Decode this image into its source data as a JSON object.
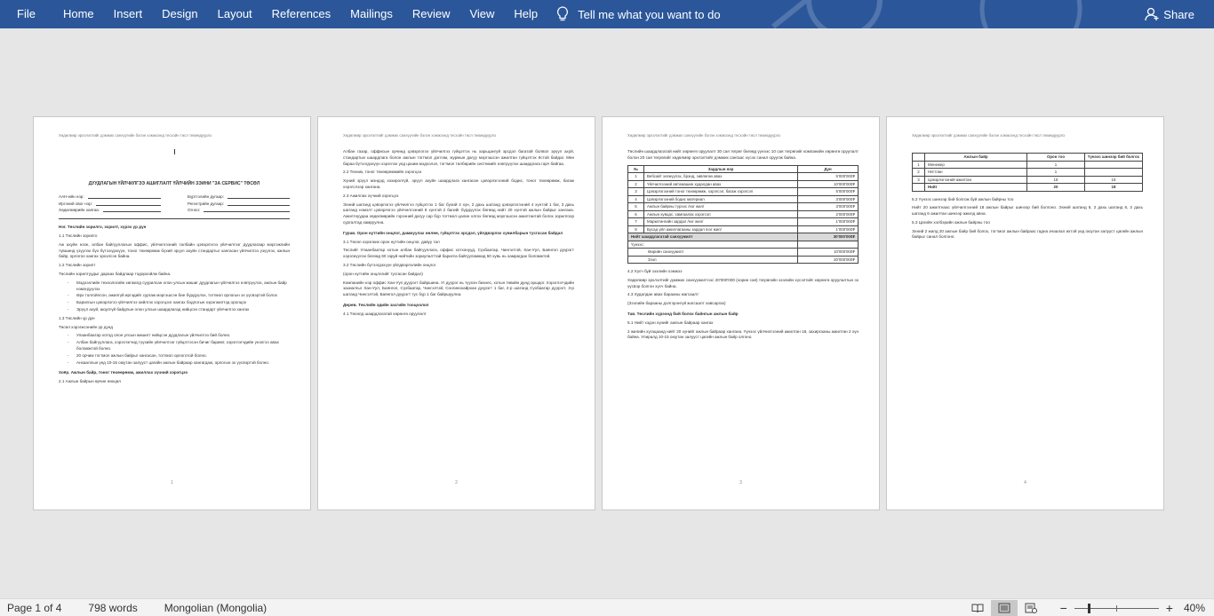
{
  "ribbon": {
    "tabs": [
      "File",
      "Home",
      "Insert",
      "Design",
      "Layout",
      "References",
      "Mailings",
      "Review",
      "View",
      "Help"
    ],
    "tell_me": "Tell me what you want to do",
    "share": "Share",
    "background_color": "#2b579a"
  },
  "pages": {
    "header_text": "Хөдөлмөр эрхэлэлтийг дэмжих санхүүгийн бэлэн хэмжээнд тесхэйн төсл текмөдуурлз",
    "p1": {
      "title": "ДУУДЛАГЫН ҮЙЛЧИЛГЭЭ АШИГЛАЛТ ҮЙЛЧИЙН ЗЭИНИ \"ЗА СЕРВИС\" ТӨСӨЛ",
      "form": [
        "ААН-ийн нэр:",
        "Бүртгэлийн дугаар:",
        "Иргэний овог нэр:",
        "Регистрийн дугаар:",
        "Хөдөлмөрийн хаягаа:",
        "Огноо:"
      ],
      "h1": "Нэг. Төслийн зорилго, зорилт, хүрэх үр дүн",
      "s11": "1.1 Төслийн зорилго",
      "p11": "Аж ахуйн нэгж, албан байгууллагын оффис, үйлчилгээний талбайн цэвэрлэгээ үйлчилгээг дуудлагаар мэргэжлийн түвшинд үзүүлэх бүх бүтээгдэхүүн, тоног төхөөрөмж бүхий эрүүл ахуйн стандартыг хангасан үйлчилгээ үзүүлэх, ажлын байр, орлогоо хангах эрхэлсэн байна.",
      "s12": "1.2 Төслийн зорилт",
      "p12": "Төслийн зорилтуудыг дараах байдлаар тодорхойлж байна.",
      "list12": [
        "Мэдээллийн технологийн хөгжилд суурилсан олон улсын жишиг дуудлагын үйлчилгээ нэвтрүүлэх, ажлын байр нэмэгдүүлэх",
        "Өрх толгойлсон, ажилгүй иргэдийг сургаж мэргэшсэн бие бүрдүүлэх, тогтмол орлогын эх үүсвэртэй болох",
        "Барилгын цэвэрлэгээ үйлчилгээ хийлгэх хэрэгцээг хангах бодлогын хэрэгжилтэд оролцох",
        "Эрүүл ахуй, аюулгүй байдлын олон улсын шаардлагад нийцсэн стандарт үйлчилгээ хангах"
      ],
      "s13": "1.3 Төслийн үр дүн",
      "p13": "Төсөл хэрэгжсэнийн үр дүнд",
      "list13": [
        "Улаанбаатар хотод олон улсын жишигт нийцсэн дуудлагын үйлчилгээ бий болно.",
        "Албан байгууллага, хэрэглэгчид түүхийн үйлчилгээг гүйцэтгэсэн бичиг баримт, хэрэглэгчдийн үнэлгээ авах боломжтой болно.",
        "20 орчим тогтмол ажлын байрыг хангасан, тогтмол орлоготой болно.",
        "Анхааллын үед 10-15 оюутан залууст цагийн ажлын байраар хангагдаж, орлогын эх үүсвэртэй болно."
      ],
      "h2": "Хоёр. Ажлын байр, тоног төхөөрөмж, ажиллах хүчний хэрэгцээ",
      "s21": "2.1 Ажлын байрын өрчин нөхцөл",
      "num": "1"
    },
    "p2": {
      "p1": "Албан газар, оффисын орчинд цэвэрлэгээ үйлчилгээ гүйцэтгэх нь харьцангуй эрсдэл багатай болвол эрүүл ахуй, стандартын шаардлага болон ажлын тогтмол дэглэм, журмын дагуу мэргэшсэн ажилтан гүйцэтгэх ёстой байдаг. Мөн бараа бүтээгдэхүүн хэрэглэх үед цахим мэдээлэл, тогтмол төлбөрийн системийг нэвтрүүлэх шаардлага гарч байгаа.",
      "s22": "2.2 Техник, тоног төхөөрөмжийн хэрэгцээ",
      "p22": "Хүний эрүүл мэндэд хохиролгүй, эрүүл ахуйн шаардлага хангасан цэвэрлэгээний бодис, тоног төхөөрөмж, багаж хэрэгслээр хангана.",
      "s23": "2.3 Ажиллах хүчний хэрэгцээ",
      "p23": "Эхний шатанд цэвэрлэгээ үйлчилгээ гүйцэтгэх 1 баг бүхий 4 хүн, 2 дахь шатанд цэвэрлэгээний 4 хүнтэй 1 баг, 3 дахь шатанд нэмэлт цэвэрлэгээ үйлчилгээний 8 хүнтэй 2 багийг бүрдүүлэх бөгөөд нийт 20 хүнтэй ажлын байрыг хангана. Ажилтнуудаа хөдөлмөрийн гэрээний дагуу сар бүр тогтмол цалин олгох бөгөөд мэргэшсэн ажилтантай болох зорилгоор сургалтад хамруулна.",
      "h3": "Гурав. Орон нутгийн онцлог, дамжуулах нөлөө, гүйцэтгэх эрсдэл, үйлдвэрлэх хувилбарын тусгасан байдал",
      "s31": "3.1 Төсөл хэрэгжих орон нутгийн онцлог, давуу тал",
      "p31": "Төслийг Улаанбаатар хотын албан байгууллага, оффис хотхонууд, Сүхбаатар, Чингэлтэй, Хан-Уул, Баянгол дүүрэгт хэрэгжүүлэх бөгөөд 60 гаруй нийтийн зориулалттай барилга байгууламжид 50 хувь нь хамрагдах боломжтой.",
      "s32": "3.2 Төслийн бүтээгдэхүүн үйлдвэрлэлийн онцлог",
      "p32a": "(орон нутгийн онцлогийг тусгасан байдал)",
      "p32": "Компанийн нэр оффис Хан-Уул дүүрэгт байршина. Уг дүүрэг нь түүхэн бизнес, хотын төвийн дунд оршдог. Хэрэглэгчдийн захиалгыг Хан-Уул, Баянгол, Сүхбаатар, Чингэлтэй, Сонгинохайрхан дүүрэгт 1 баг, 2-р шатанд Сүхбаатар дүүрэгт, 3-р шатанд Чингэлтэй, Баянгол дүүрэгт тус бүр 1 баг байршуулна.",
      "h4": "Дөрөв. Төслийн эдийн засгийн тооцоолол",
      "s41": "4.1 Төсөлд шаардлагатай хөрөнгө оруулалт",
      "num": "2"
    },
    "p3": {
      "intro": "Төслийн шаардлагатай нийт хөрөнгө оруулалт 30 сая төгрөг бөгөөд үүнээс 10 сая төгрөгийг компанийн хөрөнгө оруулалт болон 20 сая төгрөгийг хөдөлмөр эрхлэлтийг дэмжих сангаас хүсэх санал оруулж байна.",
      "table_headers": [
        "№",
        "Зардлын нэр",
        "Дүн"
      ],
      "rows": [
        [
          "1",
          "Вебсайт хөгжүүлэх, брэнд, зөвлөгөө авах",
          "5'000'000₮"
        ],
        [
          "2",
          "Үйлчилгээний автомашин худалдан авах",
          "10'000'000₮"
        ],
        [
          "3",
          "Цэвэрлэгээний тоног төхөөрөмж, хэрэгсэл, багаж хэрэгсэл",
          "5'000'000₮"
        ],
        [
          "4",
          "Цэвэрлэгээний бодис материал",
          "3'000'000₮"
        ],
        [
          "5",
          "Ажлын байрны түрээс /нэг жил/",
          "3'000'000₮"
        ],
        [
          "6",
          "Ажлын хувцас, хамгаалах хэрэгсэл",
          "2'000'000₮"
        ],
        [
          "7",
          "Маркетингийн зардал /нэг жил/",
          "1'000'000₮"
        ],
        [
          "8",
          "Бусад үйл ажиллагааны зардал /нэг жил/",
          "1'000'000₮"
        ]
      ],
      "total": [
        "Нийт шаардлагатай санхүүжилт",
        "30'000'000₮"
      ],
      "sources_label": "Үүнээс:",
      "sources": [
        [
          "Өөрийн санхүүжилт",
          "10'000'000₮"
        ],
        [
          "Зээл",
          "20'000'000₮"
        ]
      ],
      "s42": "4.2 Хүсч буй зээлийн хэмжээ",
      "p42": "Хөдөлмөр эрхлэлтийг дэмжих санхүүжилтээс 20'000'000 (хорин сая) төгрөгийн зээлийн хүсэлтийг хөрөнгө оруулалтын эх үүсвэр болгон хүсч байна.",
      "s43": "4.3 Худалдан авах барааны жагсаалт",
      "p43": "(Зээлийн барааны дэлгэрэнгүй жагсаалт хавсаргах)",
      "h5": "Тав. Төслийн хүрээнд бий болох байнгын ажлын байр",
      "s51": "5.1 Нийт хэдэн хүнийг ажлын байраар хангах",
      "p51": "2 жилийн хугацаанд нийт 20 хүнийг ажлын байраар хангана. Үүнээс үйлчилгээний ажилтан 18, захиргааны ажилтан 2 хүн байна. Улиралд 10-15 оюутан залууст цагийн ажлын байр олгоно.",
      "num": "3"
    },
    "p4": {
      "headers": [
        "Ажлын байр",
        "Орон тоо",
        "Үүнээс шинээр бий болгох"
      ],
      "rows": [
        [
          "1",
          "Менежер",
          "1",
          ""
        ],
        [
          "2",
          "Нягтлан",
          "1",
          ""
        ],
        [
          "3",
          "Цэвэрлэгээний ажилтан",
          "18",
          "18"
        ]
      ],
      "total": [
        "Нийт",
        "20",
        "18"
      ],
      "s52": "5.2 Үүнээс шинээр бий болгож буй ажлын байрны тоо",
      "p52": "Нийт 20 ажилтнаас үйлчилгээний 18 ажлын байрыг шинээр бий болгоно. Эхний шатанд 6, 2 дахь шатанд 6, 3 дахь шатанд 6 ажилтан шинээр ажилд авна.",
      "s53": "5.3 Цагийн хэлбэрийн ажлын байрны тоо",
      "p53": "Эхний 2 жилд 20 ажлын байр бий болох, тогтмол ажлын байраас гадна ачаалал ихтэй үед оюутан залууст цагийн ажлын байрыг санал болгоно.",
      "num": "4"
    }
  },
  "status": {
    "page": "Page 1 of 4",
    "words": "798 words",
    "language": "Mongolian (Mongolia)",
    "zoom": "40%",
    "zoom_level": 0.4
  }
}
